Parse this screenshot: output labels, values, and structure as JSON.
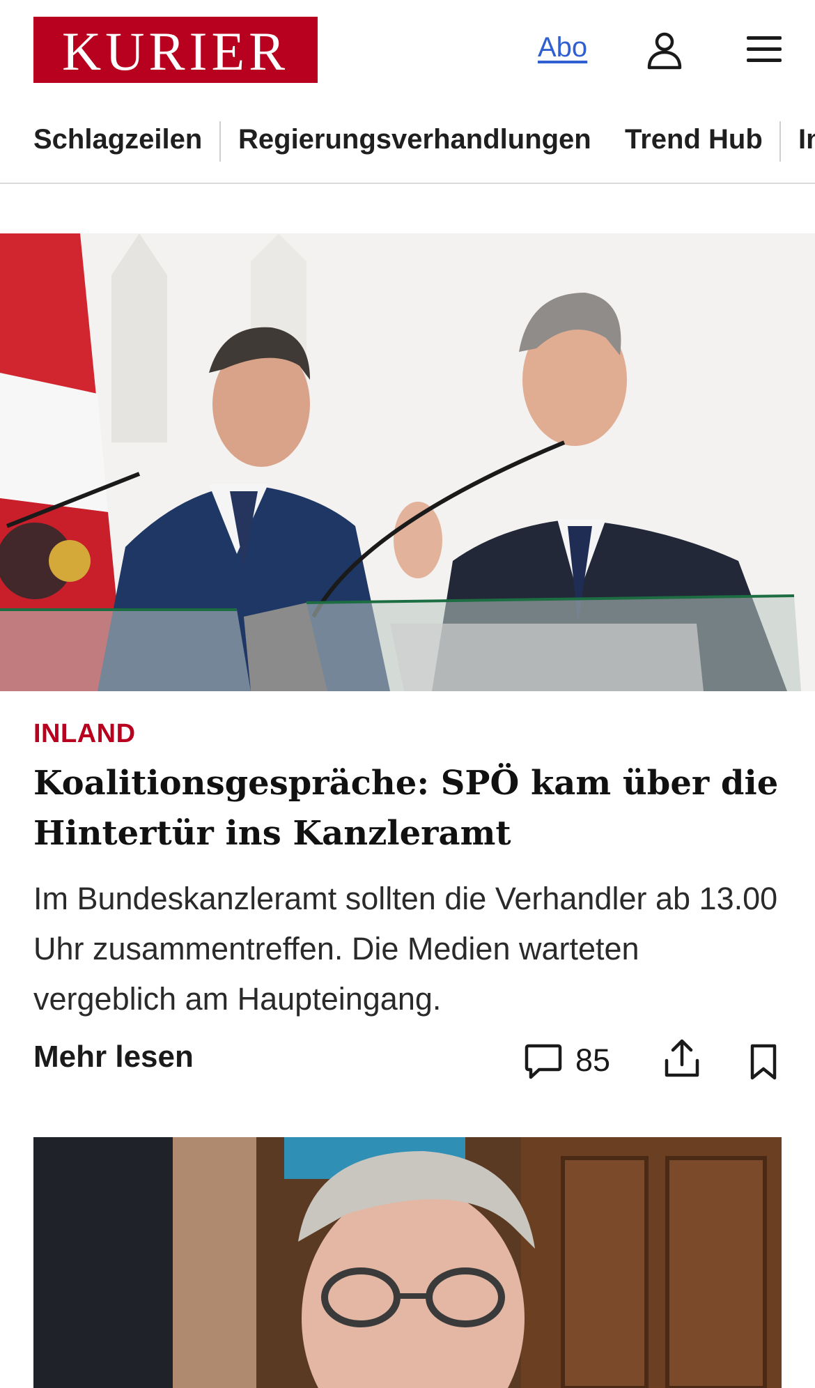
{
  "header": {
    "logo_text": "KURIER",
    "abo_label": "Abo",
    "icons": {
      "user": "user-icon",
      "menu": "hamburger-menu-icon"
    },
    "colors": {
      "brand": "#b8001f",
      "link": "#2f5fd0"
    }
  },
  "nav": {
    "items": [
      {
        "label": "Schlagzeilen"
      },
      {
        "label": "Regierungsverhandlungen"
      },
      {
        "label": "Trend Hub"
      },
      {
        "label": "In"
      }
    ]
  },
  "articles": [
    {
      "image": "press-conference-photo",
      "kicker": "INLAND",
      "headline": "Koalitionsgespräche: SPÖ kam über die Hintertür ins Kanzleramt",
      "teaser": "Im Bundeskanzleramt sollten die Verhandler ab 13.00 Uhr zusammentreffen. Die Medien warteten vergeblich am Haupteingang.",
      "more_label": "Mehr lesen",
      "comment_count": "85",
      "icons": {
        "comment": "comment-icon",
        "share": "share-icon",
        "bookmark": "bookmark-icon"
      }
    },
    {
      "image": "portrait-photo"
    }
  ]
}
